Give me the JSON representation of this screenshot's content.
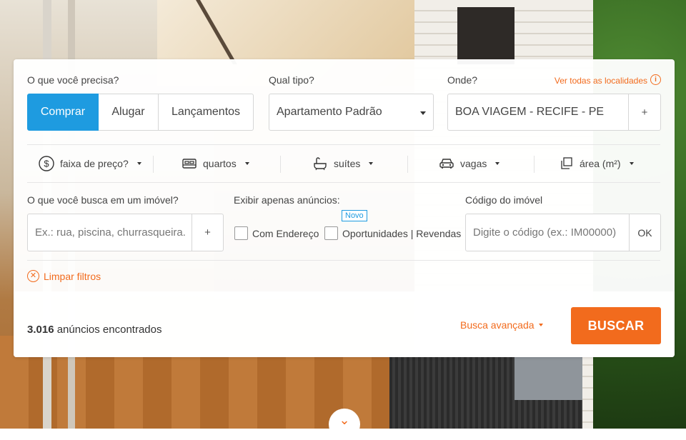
{
  "need": {
    "label": "O que você precisa?",
    "options": [
      "Comprar",
      "Alugar",
      "Lançamentos"
    ],
    "selected": "Comprar"
  },
  "type": {
    "label": "Qual tipo?",
    "value": "Apartamento Padrão"
  },
  "where": {
    "label": "Onde?",
    "value": "BOA VIAGEM - RECIFE - PE",
    "add": "+",
    "all_locations": "Ver todas as localidades",
    "info_icon": "i"
  },
  "filters": {
    "price": {
      "label": "faixa de preço?",
      "icon": "dollar-circle-icon"
    },
    "rooms": {
      "label": "quartos",
      "icon": "bed-icon"
    },
    "suites": {
      "label": "suítes",
      "icon": "bathtub-icon"
    },
    "parking": {
      "label": "vagas",
      "icon": "car-icon"
    },
    "area": {
      "label": "área (m²)",
      "icon": "area-icon"
    }
  },
  "keyword": {
    "label": "O que você busca em um imóvel?",
    "placeholder": "Ex.: rua, piscina, churrasqueira.",
    "add": "+"
  },
  "only": {
    "label": "Exibir apenas anúncios:",
    "address": "Com Endereço",
    "opportunities": "Oportunidades | Revendas",
    "new_badge": "Novo"
  },
  "code": {
    "label": "Código do imóvel",
    "placeholder": "Digite o código (ex.: IM00000)",
    "ok": "OK"
  },
  "clear_filters": "Limpar filtros",
  "results": {
    "count": "3.016",
    "suffix": "anúncios encontrados"
  },
  "advanced": "Busca avançada",
  "search_button": "BUSCAR",
  "colors": {
    "accent": "#f26b1d",
    "primary": "#1e9be0"
  }
}
